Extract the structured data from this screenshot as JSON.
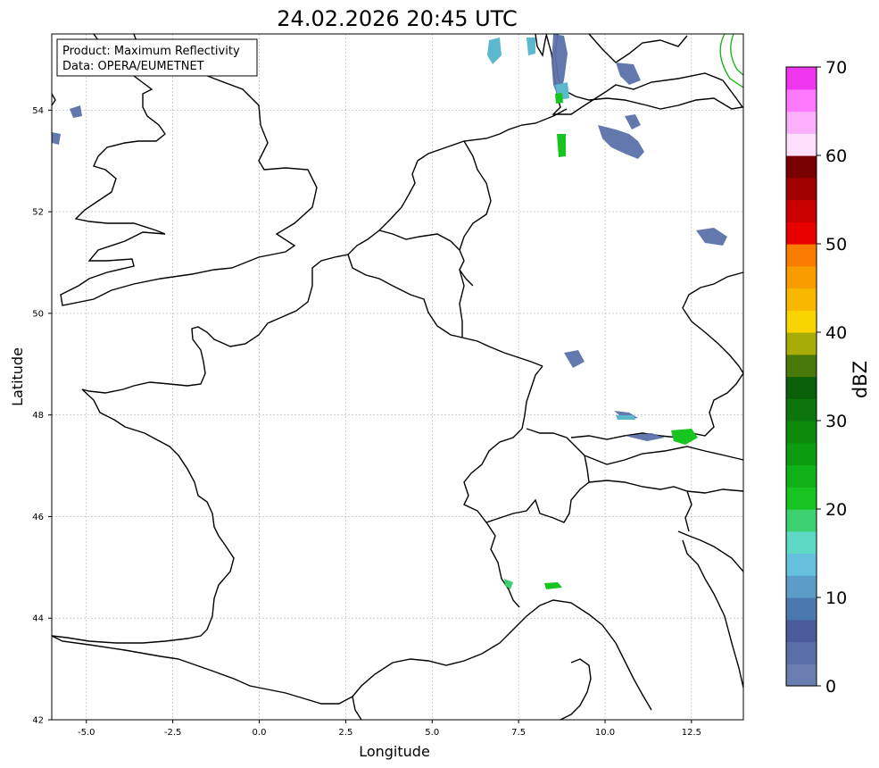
{
  "title": "24.02.2026 20:45 UTC",
  "info_box": {
    "line1": "Product: Maximum Reflectivity",
    "line2": "Data: OPERA/EUMETNET"
  },
  "axes": {
    "xlabel": "Longitude",
    "ylabel": "Latitude",
    "xlim": [
      -6,
      14
    ],
    "ylim": [
      42,
      55.5
    ],
    "xticks": [
      "-5.0",
      "-2.5",
      "0.0",
      "2.5",
      "5.0",
      "7.5",
      "10.0",
      "12.5"
    ],
    "xtick_values": [
      -5,
      -2.5,
      0,
      2.5,
      5,
      7.5,
      10,
      12.5
    ],
    "yticks": [
      "42",
      "44",
      "46",
      "48",
      "50",
      "52",
      "54"
    ],
    "ytick_values": [
      42,
      44,
      46,
      48,
      50,
      52,
      54
    ],
    "grid": true
  },
  "colorbar": {
    "label": "dBZ",
    "range": [
      0,
      70
    ],
    "tick_labels": [
      "0",
      "10",
      "20",
      "30",
      "40",
      "50",
      "60",
      "70"
    ],
    "tick_values": [
      0,
      10,
      20,
      30,
      40,
      50,
      60,
      70
    ],
    "colors": [
      "#6a7fb0",
      "#5a6ea8",
      "#4a5c9c",
      "#4c78b0",
      "#5c9cc8",
      "#64c0dc",
      "#5cd8c4",
      "#3cd070",
      "#18c420",
      "#10b018",
      "#0c9c10",
      "#0c8a0c",
      "#0c760c",
      "#0a6008",
      "#487808",
      "#a8ac08",
      "#f8d400",
      "#f8b800",
      "#f89c00",
      "#f87c00",
      "#e80000",
      "#c80000",
      "#a00000",
      "#780000",
      "#fce0fc",
      "#fcb0fc",
      "#fc78fc",
      "#ee36ee"
    ]
  },
  "colors": {
    "grid": "#b0b0b0",
    "coast": "#000000",
    "green_contour": "#10b010"
  }
}
